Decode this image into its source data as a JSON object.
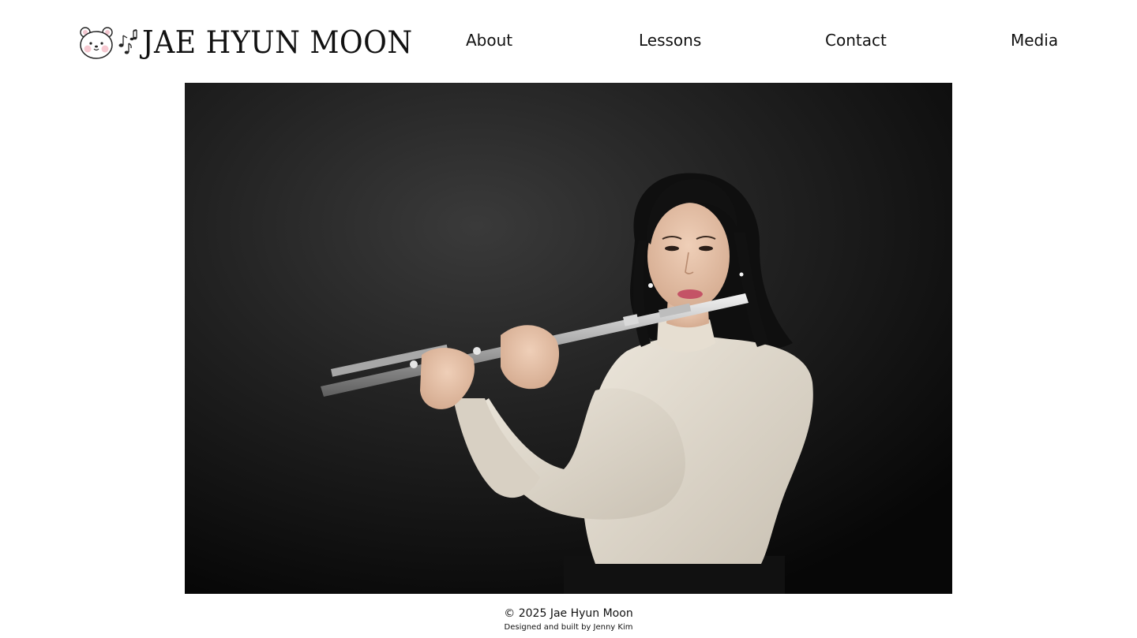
{
  "header": {
    "site_title": "JAE HYUN MOON",
    "logo_icon": "bear-face-icon",
    "notes_icon": "music-notes-icon"
  },
  "nav": {
    "items": [
      {
        "label": "About"
      },
      {
        "label": "Lessons"
      },
      {
        "label": "Contact"
      },
      {
        "label": "Media"
      }
    ]
  },
  "hero": {
    "image_subject": "portrait-photo"
  },
  "footer": {
    "copyright": "© 2025 Jae Hyun Moon",
    "credit": "Designed and built by Jenny Kim"
  },
  "colors": {
    "background": "#ffffff",
    "text": "#111111",
    "photo_backdrop": "#1a1a1a"
  }
}
